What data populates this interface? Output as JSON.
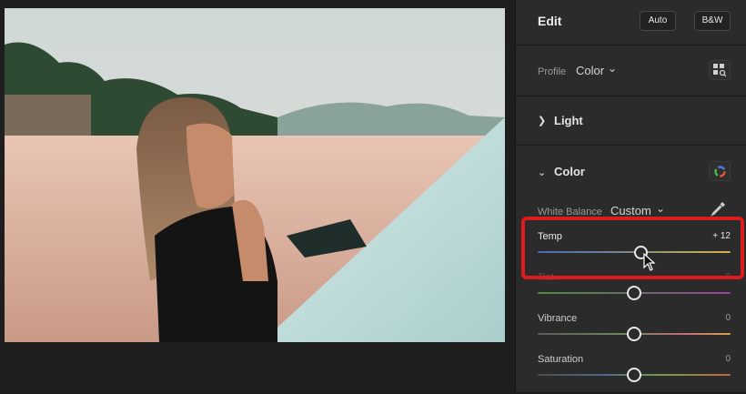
{
  "editor": {
    "title": "Edit",
    "auto_label": "Auto",
    "bw_label": "B&W"
  },
  "profile": {
    "label": "Profile",
    "value": "Color",
    "browse_icon": "grid-browse-icon"
  },
  "sections": {
    "light": {
      "label": "Light",
      "expanded": false
    },
    "color": {
      "label": "Color",
      "expanded": true
    }
  },
  "white_balance": {
    "label": "White Balance",
    "value": "Custom",
    "eyedropper_icon": "eyedropper-icon"
  },
  "sliders": {
    "temp": {
      "label": "Temp",
      "value": "+ 12",
      "fraction": 0.54
    },
    "tint": {
      "label": "Tint",
      "value": "0",
      "fraction": 0.5
    },
    "vibrance": {
      "label": "Vibrance",
      "value": "0",
      "fraction": 0.5
    },
    "saturation": {
      "label": "Saturation",
      "value": "0",
      "fraction": 0.5
    }
  },
  "colors": {
    "panel_bg": "#2b2b2b",
    "highlight": "#e01b1b"
  }
}
